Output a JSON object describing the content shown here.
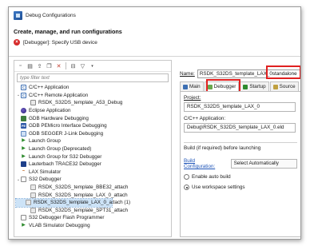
{
  "window": {
    "title": "Debug Configurations"
  },
  "header": {
    "title": "Create, manage, and run configurations",
    "message": "[Debugger]: Specify USB device"
  },
  "left": {
    "filter_placeholder": "type filter text",
    "tree": [
      {
        "label": "C/C++ Application",
        "twisty": "",
        "icon": "c"
      },
      {
        "label": "C/C++ Remote Application",
        "twisty": "v",
        "icon": "c"
      },
      {
        "label": "RSDK_S32DS_template_A53_Debug",
        "twisty": "",
        "icon": "cfg",
        "indent": 1
      },
      {
        "label": "Eclipse Application",
        "twisty": "",
        "icon": "eclipse"
      },
      {
        "label": "GDB Hardware Debugging",
        "twisty": "",
        "icon": "gdb"
      },
      {
        "label": "GDB PEMicro Interface Debugging",
        "twisty": "",
        "icon": "pe"
      },
      {
        "label": "GDB SEGGER J-Link Debugging",
        "twisty": "",
        "icon": "segger"
      },
      {
        "label": "Launch Group",
        "twisty": "",
        "icon": "launch"
      },
      {
        "label": "Launch Group (Deprecated)",
        "twisty": "",
        "icon": "launch"
      },
      {
        "label": "Launch Group for S32 Debugger",
        "twisty": "",
        "icon": "launch"
      },
      {
        "label": "Lauterbach TRACE32 Debugger",
        "twisty": "",
        "icon": "trace"
      },
      {
        "label": "LAX Simulator",
        "twisty": "",
        "icon": "lax"
      },
      {
        "label": "S32 Debugger",
        "twisty": "v",
        "icon": "s32"
      },
      {
        "label": "RSDK_S32DS_template_BBE32_attach",
        "twisty": "",
        "icon": "dbg",
        "indent": 1
      },
      {
        "label": "RSDK_S32DS_template_LAX_0_attach",
        "twisty": "",
        "icon": "dbg",
        "indent": 1
      },
      {
        "label": "RSDK_S32DS_template_LAX_0_attach (1)",
        "twisty": "",
        "icon": "dbg",
        "indent": 1,
        "selected": true
      },
      {
        "label": "RSDK_S32DS_template_SPT31_attach",
        "twisty": "",
        "icon": "dbg",
        "indent": 1
      },
      {
        "label": "S32 Debugger Flash Programmer",
        "twisty": "",
        "icon": "flash"
      },
      {
        "label": "VLAB Simulator Debugging",
        "twisty": "",
        "icon": "vlab"
      }
    ]
  },
  "right": {
    "name_label": "Name:",
    "name_value_prefix": "RSDK_S32DS_template_LAX_0",
    "name_value_suffix": "standalone",
    "tabs": [
      {
        "label": "Main",
        "active": false
      },
      {
        "label": "Debugger",
        "active": true
      },
      {
        "label": "Startup",
        "active": false
      },
      {
        "label": "Source",
        "active": false
      }
    ],
    "project_label": "Project:",
    "project_value": "RSDK_S32DS_template_LAX_0",
    "app_label": "C/C++ Application:",
    "app_value": "Debug\\RSDK_S32DS_template_LAX_0.eld",
    "build_title": "Build (if required) before launching",
    "build_config_link": "Build Configuration:",
    "build_config_value": "Select Automatically",
    "radio_auto": "Enable auto build",
    "radio_workspace": "Use workspace settings"
  },
  "colors": {
    "highlight": "#e02020",
    "link": "#1f55b8",
    "selection": "#cde3f7"
  }
}
